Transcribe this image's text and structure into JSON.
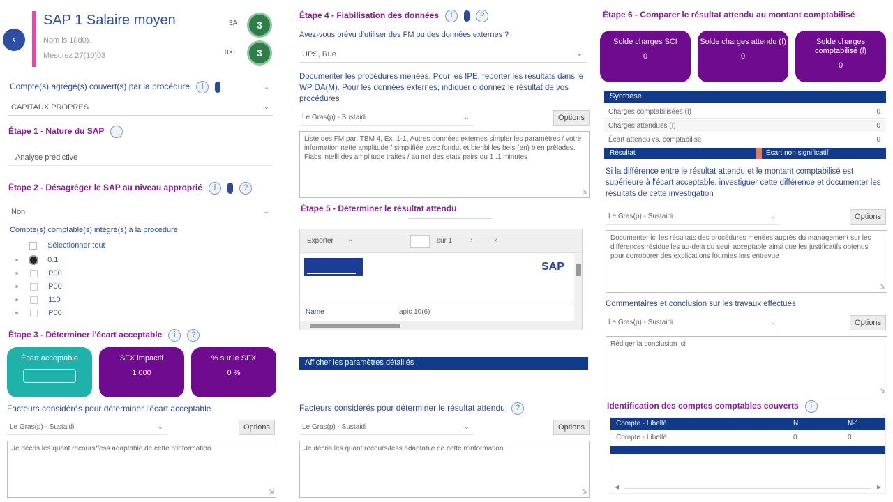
{
  "header": {
    "title": "SAP 1 Salaire moyen",
    "subtitle_line1": "Nom is 1(id0).",
    "subtitle_line2": "Mesurez 27(10)03",
    "badge1_label": "3A",
    "badge1_value": "3",
    "badge2_label": "0XI",
    "badge2_value": "3"
  },
  "col1": {
    "accounts_label": "Compte(s) agrégé(s) couvert(s) par la procédure",
    "accounts_value": "CAPITAUX PROPRES",
    "step1_title": "Étape 1 - Nature du SAP",
    "step1_value": "Analyse prédictive",
    "step2_title": "Étape 2 - Désagréger le SAP au niveau approprié",
    "step2_select": "Non",
    "step2_list_label": "Compte(s) comptable(s) intégré(s) à la procédure",
    "list_items": [
      "Sélectionner tout",
      "0.1",
      "P00",
      "P00",
      "110",
      "P00"
    ],
    "step3_title": "Étape 3 - Déterminer l'écart acceptable",
    "tiles": [
      {
        "label": "Écart acceptable",
        "value": ""
      },
      {
        "label": "SFX impactif",
        "value": "1 000"
      },
      {
        "label": "% sur le SFX",
        "value": "0 %"
      }
    ],
    "factors_label": "Facteurs considérés pour déterminer l'écart acceptable",
    "font_select": "Le Gras(p) - Sustaidi",
    "options_button": "Options",
    "factors_text": "Je décris les quant recours/fess adaptable de cette n'information"
  },
  "col2": {
    "step4_title": "Étape 4 - Fiabilisation des données",
    "question": "Avez-vous prévu d'utiliser des FM ou des données externes ?",
    "question_value": "UPS, Rue",
    "instruction": "Documenter les procédures menées. Pour les IPE, reporter les résultats dans le WP DA(M). Pour les données externes, indiquer o donnez le résultat de vos procédures",
    "font_select": "Le Gras(p) - Sustaidi",
    "options_button": "Options",
    "text_content": "Liste des FM par: TBM 4, Ex. 1-1, Autres données externes simpler les paramètres / votre information nette amplitude / simplifiée avec fondut et bienbl les bels (en) bien prêlades. Fiabs intelll des amplitude traités / au net des etats pairs du 1 .1 minutes",
    "step5_title": "Étape 5 - Déterminer le résultat attendu",
    "report_toolbar": "Exporter",
    "report_page": "sur 1",
    "report_logo": "SAP",
    "report_row_label": "Name",
    "report_row_value": "apic 10(6)",
    "blue_section": "Afficher les paramètres détaillés",
    "factors_label": "Facteurs considérés pour déterminer le résultat attendu",
    "factors_font_select": "Le Gras(p) - Sustaidi",
    "factors_options": "Options",
    "factors_text": "Je décris les quant recours/fess adaptable de cette n'information"
  },
  "col3": {
    "step6_title": "Étape 6 - Comparer le résultat attendu au montant comptabilisé",
    "tiles": [
      {
        "label": "Solde charges SCI",
        "value": "0"
      },
      {
        "label": "Solde charges attendu (I)",
        "value": "0"
      },
      {
        "label": "Solde charges comptabilisé (l)",
        "value": "0"
      }
    ],
    "table_header": "Synthèse",
    "table_rows": [
      {
        "label": "Charges comptabilisées (I)",
        "value": "0"
      },
      {
        "label": "Charges attendues (I)",
        "value": "0"
      },
      {
        "label": "Écart attendu vs. comptabilisé",
        "value": "0"
      }
    ],
    "result_label": "Résultat",
    "result_value": "Écart non significatif",
    "diff_text": "Si la différence entre le résultat attendu et le montant comptabilisé est supérieure à l'écart acceptable, investiguer cette différence et documenter les résultats de cette investigation",
    "font_select": "Le Gras(p) - Sustaidi",
    "options_button": "Options",
    "diff_textarea": "Documenter ici les résultats des procédures menées auprès du management sur les différences résiduelles au-delà du seuil acceptable ainsi que les justificatifs obtenus pour corroborer des explications fournies lors entrevue",
    "comments_label": "Commentaires et conclusion sur les travaux effectués",
    "comments_font_select": "Le Gras(p) - Sustaidi",
    "comments_options": "Options",
    "comments_text": "Rédiger la conclusion ici",
    "ident_title": "Identification des comptes comptables couverts",
    "ident_header_cols": [
      "Compte - Libellé",
      "N",
      "N-1"
    ],
    "ident_rows": [
      {
        "label": "Compte - Libellé",
        "n": "0",
        "n1": "0"
      }
    ]
  }
}
